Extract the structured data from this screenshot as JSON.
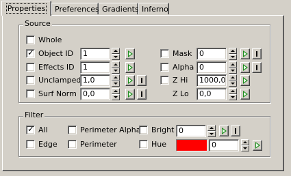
{
  "tabs": {
    "properties": "Properties",
    "preferences": "Preferences",
    "gradients": "Gradients",
    "inferno": "Inferno"
  },
  "source": {
    "title": "Source",
    "whole": {
      "label": "Whole",
      "checked": false
    },
    "object_id": {
      "label": "Object ID",
      "checked": true,
      "value": "1"
    },
    "effects_id": {
      "label": "Effects ID",
      "checked": false,
      "value": "1"
    },
    "unclamped": {
      "label": "Unclamped",
      "checked": false,
      "value": "1,0"
    },
    "surf_norm": {
      "label": "Surf Norm",
      "checked": false,
      "value": "0,0"
    },
    "mask": {
      "label": "Mask",
      "checked": false,
      "value": "0"
    },
    "alpha": {
      "label": "Alpha",
      "checked": false,
      "value": "0"
    },
    "z_hi": {
      "label": "Z Hi",
      "checked": false,
      "value": "1000,0"
    },
    "z_lo": {
      "label": "Z Lo",
      "value": "0,0"
    }
  },
  "filter": {
    "title": "Filter",
    "all": {
      "label": "All",
      "checked": true
    },
    "edge": {
      "label": "Edge",
      "checked": false
    },
    "perimeter_alpha": {
      "label": "Perimeter Alpha",
      "checked": false
    },
    "perimeter": {
      "label": "Perimeter",
      "checked": false
    },
    "bright": {
      "label": "Bright",
      "checked": false,
      "value": "0"
    },
    "hue": {
      "label": "Hue",
      "checked": false,
      "value": "0",
      "color": "#ff0000"
    }
  },
  "icons": {
    "arrow": "green-arrow-icon",
    "bar": "bar-icon"
  }
}
